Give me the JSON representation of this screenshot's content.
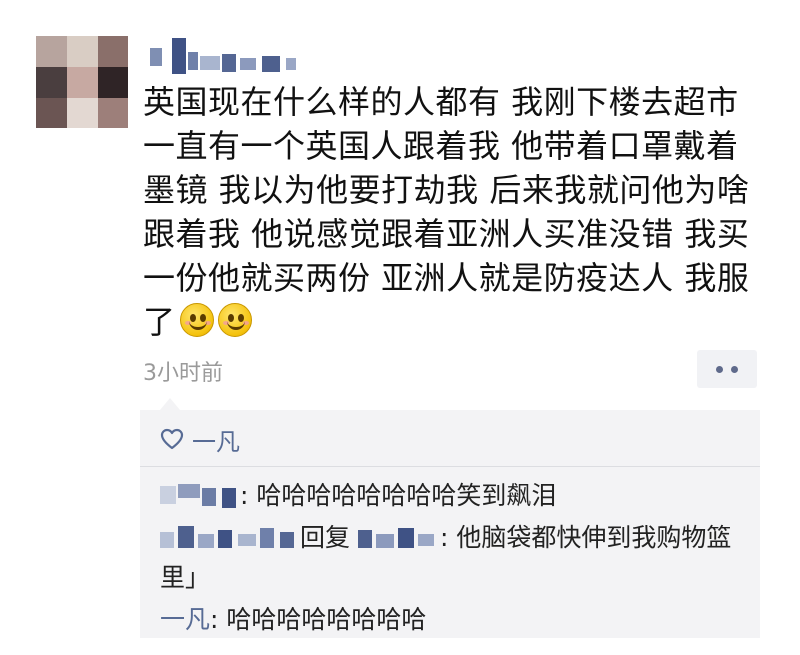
{
  "post": {
    "text": "英国现在什么样的人都有 我刚下楼去超市一直有一个英国人跟着我 他带着口罩戴着墨镜 我以为他要打劫我 后来我就问他为啥跟着我 他说感觉跟着亚洲人买准没错 我买一份他就买两份 亚洲人就是防疫达人 我服了",
    "timestamp": "3小时前",
    "emojis": [
      "smiling-face-icon",
      "smiling-face-icon"
    ]
  },
  "comments": {
    "likes": {
      "icon": "heart-outline-icon",
      "liker": "一凡"
    },
    "items": [
      {
        "text": ": 哈哈哈哈哈哈哈哈笑到飙泪"
      },
      {
        "reply_label": "回复",
        "text": ": 他脑袋都快伸到我购物篮里」"
      },
      {
        "author": "一凡",
        "text": ": 哈哈哈哈哈哈哈哈"
      }
    ]
  },
  "colors": {
    "link": "#576b95",
    "timestamp": "#9a9a9a",
    "comment_bg": "#f3f3f5"
  }
}
